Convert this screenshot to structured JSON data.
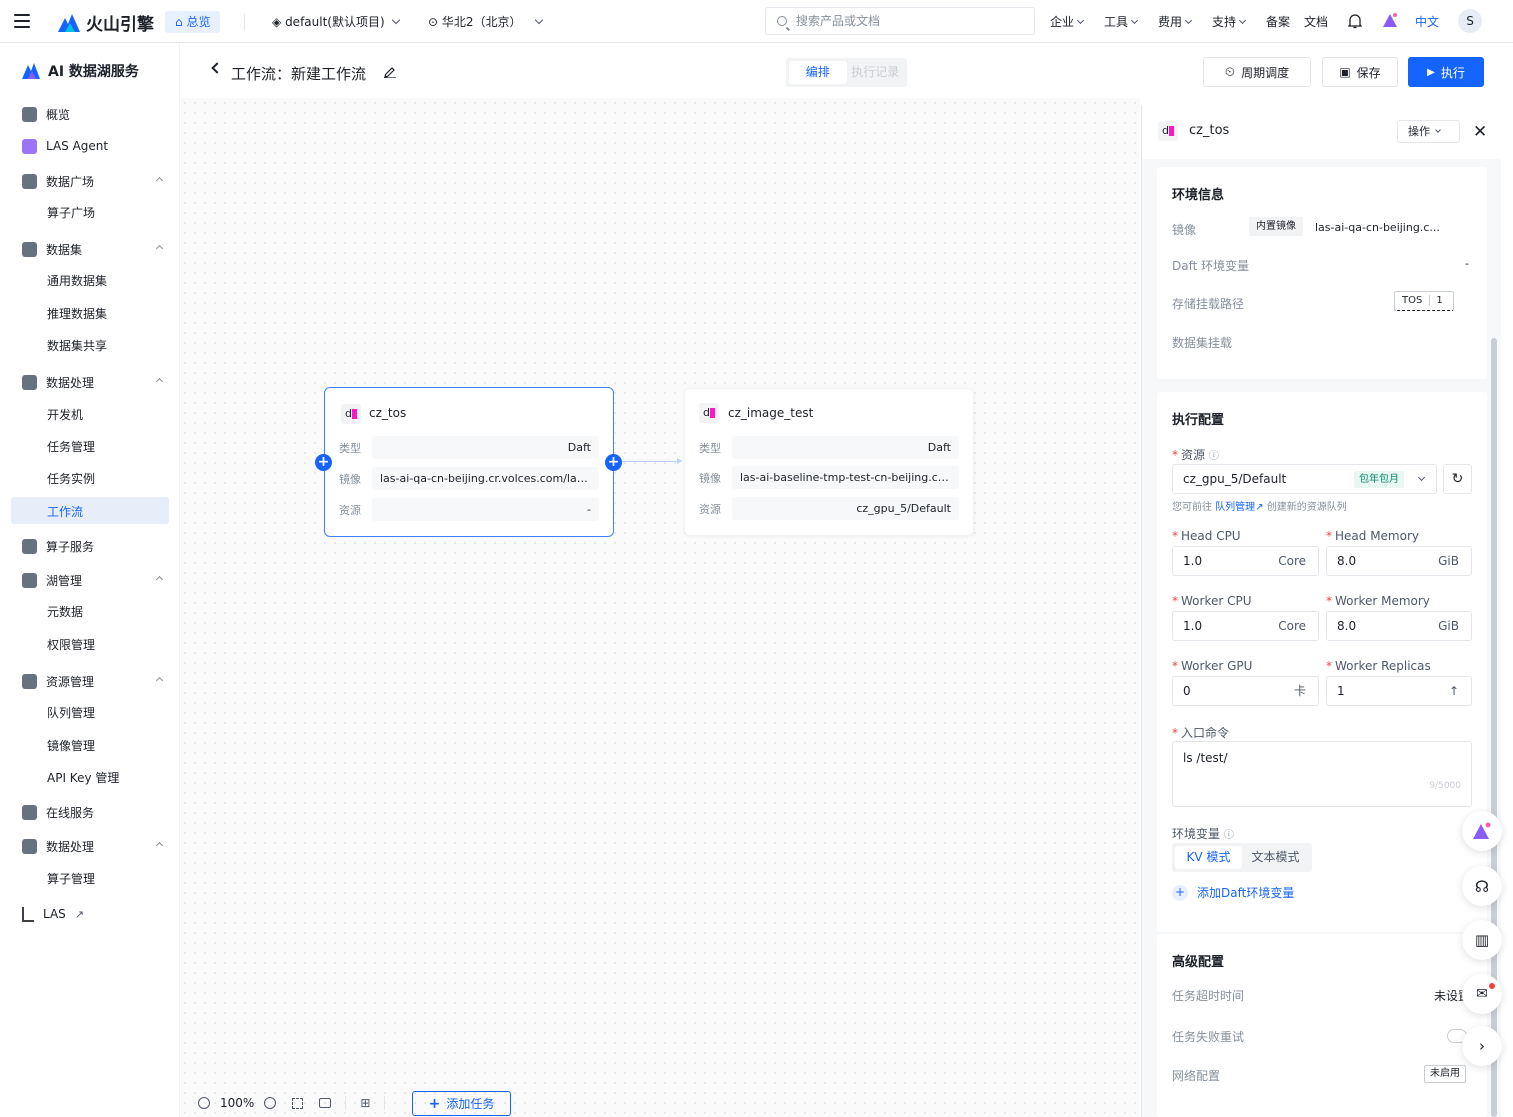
{
  "topbar": {
    "brand": "火山引擎",
    "overview": "总览",
    "project": "default(默认项目)",
    "region": "华北2（北京）",
    "search_placeholder": "搜索产品或文档",
    "menus": [
      "企业",
      "工具",
      "费用",
      "支持",
      "备案",
      "文档"
    ],
    "lang": "中文",
    "avatar": "S"
  },
  "sidebar": {
    "title": "AI 数据湖服务",
    "items": [
      {
        "label": "概览"
      },
      {
        "label": "LAS Agent"
      },
      {
        "label": "数据广场",
        "children": [
          "算子广场"
        ]
      },
      {
        "label": "数据集",
        "children": [
          "通用数据集",
          "推理数据集",
          "数据集共享"
        ]
      },
      {
        "label": "数据处理",
        "children": [
          "开发机",
          "任务管理",
          "任务实例",
          "工作流"
        ]
      },
      {
        "label": "算子服务"
      },
      {
        "label": "湖管理",
        "children": [
          "元数据",
          "权限管理"
        ]
      },
      {
        "label": "资源管理",
        "children": [
          "队列管理",
          "镜像管理",
          "API Key 管理"
        ]
      },
      {
        "label": "在线服务"
      },
      {
        "label": "数据处理",
        "children": [
          "算子管理"
        ]
      },
      {
        "label": "LAS"
      }
    ]
  },
  "header": {
    "title": "工作流：新建工作流",
    "tabs": [
      "编排",
      "执行记录"
    ],
    "schedule_btn": "周期调度",
    "save_btn": "保存",
    "run_btn": "执行"
  },
  "nodes": [
    {
      "icon_letter": "d",
      "name": "cz_tos",
      "rows": [
        {
          "k": "类型",
          "v": "Daft"
        },
        {
          "k": "镜像",
          "v": "las-ai-qa-cn-beijing.cr.volces.com/las/v..."
        },
        {
          "k": "资源",
          "v": "-"
        }
      ]
    },
    {
      "icon_letter": "d",
      "name": "cz_image_test",
      "rows": [
        {
          "k": "类型",
          "v": "Daft"
        },
        {
          "k": "镜像",
          "v": "las-ai-baseline-tmp-test-cn-beijing.cr.v..."
        },
        {
          "k": "资源",
          "v": "cz_gpu_5/Default"
        }
      ]
    }
  ],
  "bottom_toolbar": {
    "zoom": "100%",
    "add_task": "添加任务"
  },
  "panel": {
    "icon_letter": "d",
    "title": "cz_tos",
    "ops": "操作",
    "env_info": {
      "heading": "环境信息",
      "image_label": "镜像",
      "image_tag": "内置镜像",
      "image_value": "las-ai-qa-cn-beijing.c...",
      "daft_env_label": "Daft 环境变量",
      "daft_env_value": "-",
      "storage_label": "存储挂载路径",
      "storage_tag": "TOS",
      "storage_count": "1",
      "dataset_label": "数据集挂载"
    },
    "exec": {
      "heading": "执行配置",
      "resource_label": "资源",
      "resource_value": "cz_gpu_5/Default",
      "resource_badge": "包年包月",
      "hint_prefix": "您可前往",
      "hint_link": "队列管理",
      "hint_suffix": "创建新的资源队列",
      "head_cpu_label": "Head CPU",
      "head_cpu": "1.0",
      "head_cpu_unit": "Core",
      "head_mem_label": "Head Memory",
      "head_mem": "8.0",
      "head_mem_unit": "GiB",
      "worker_cpu_label": "Worker CPU",
      "worker_cpu": "1.0",
      "worker_cpu_unit": "Core",
      "worker_mem_label": "Worker Memory",
      "worker_mem": "8.0",
      "worker_mem_unit": "GiB",
      "worker_gpu_label": "Worker GPU",
      "worker_gpu": "0",
      "worker_gpu_unit": "卡",
      "replicas_label": "Worker Replicas",
      "replicas": "1",
      "cmd_label": "入口命令",
      "cmd": "ls /test/",
      "cmd_count": "9/5000",
      "env_label": "环境变量",
      "env_tabs": [
        "KV 模式",
        "文本模式"
      ],
      "add_env": "添加Daft环境变量"
    },
    "advanced": {
      "heading": "高级配置",
      "timeout_label": "任务超时时间",
      "timeout_value": "未设置",
      "retry_label": "任务失败重试",
      "network_label": "网络配置",
      "network_value": "未启用"
    }
  },
  "colors": {
    "primary": "#1664ff",
    "required": "#f53f3f",
    "badge_green": "#0e8a6e"
  }
}
